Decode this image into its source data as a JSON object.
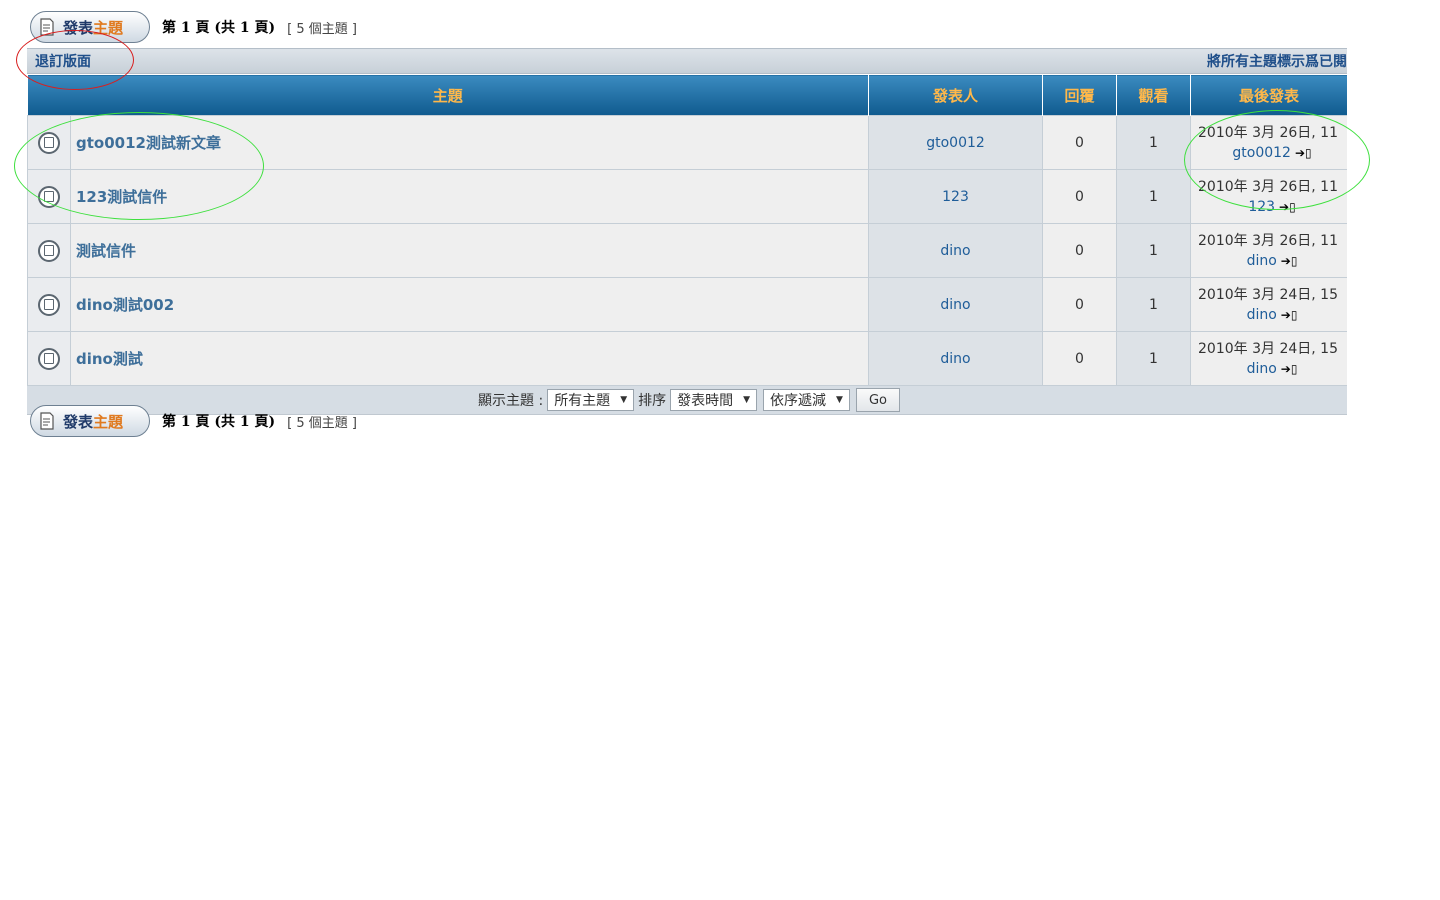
{
  "toolbar": {
    "new_topic_part1": "發表",
    "new_topic_part2": "主題",
    "pagination": "第 1 頁 (共 1 頁)",
    "topic_count": "[ 5 個主題 ]"
  },
  "category_bar": {
    "unsubscribe": "退訂版面",
    "mark_read": "將所有主題標示爲已閱"
  },
  "table": {
    "headers": {
      "topic": "主題",
      "author": "發表人",
      "replies": "回覆",
      "views": "觀看",
      "last_post": "最後發表"
    },
    "rows": [
      {
        "title": "gto0012測試新文章",
        "author": "gto0012",
        "replies": "0",
        "views": "1",
        "last_date": "2010年 3月 26日, 11",
        "last_user": "gto0012"
      },
      {
        "title": "123測試信件",
        "author": "123",
        "replies": "0",
        "views": "1",
        "last_date": "2010年 3月 26日, 11",
        "last_user": "123"
      },
      {
        "title": "測試信件",
        "author": "dino",
        "replies": "0",
        "views": "1",
        "last_date": "2010年 3月 26日, 11",
        "last_user": "dino"
      },
      {
        "title": "dino測試002",
        "author": "dino",
        "replies": "0",
        "views": "1",
        "last_date": "2010年 3月 24日, 15",
        "last_user": "dino"
      },
      {
        "title": "dino測試",
        "author": "dino",
        "replies": "0",
        "views": "1",
        "last_date": "2010年 3月 24日, 15",
        "last_user": "dino"
      }
    ]
  },
  "filter": {
    "show_label": "顯示主題 :",
    "show_value": "所有主題",
    "sort_label": "排序",
    "sort_value": "發表時間",
    "order_value": "依序遞減",
    "go_label": "Go"
  },
  "colors": {
    "header_text": "#ffb84a",
    "link": "#1f5d99",
    "annotation_red": "#d81f1f",
    "annotation_green": "#3ee03e"
  }
}
